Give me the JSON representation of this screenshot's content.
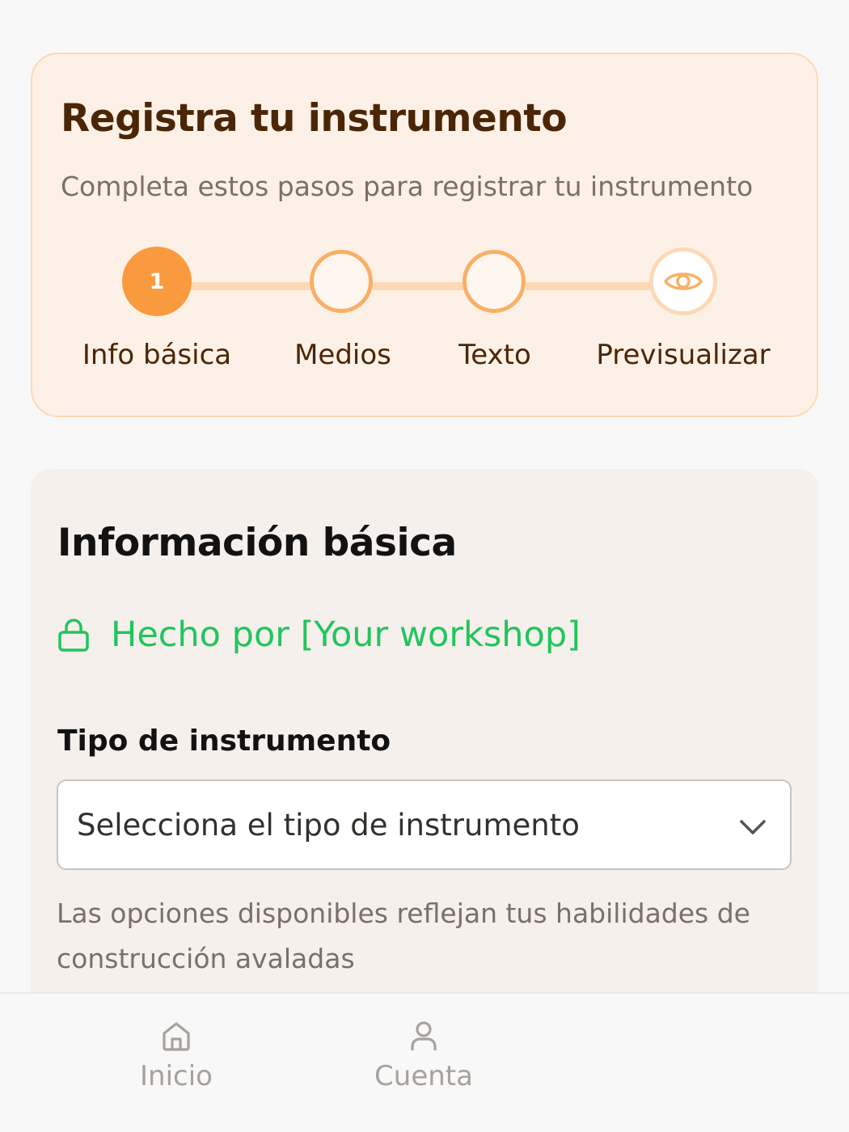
{
  "header": {
    "title": "Registra tu instrumento",
    "subtitle": "Completa estos pasos para registrar tu instrumento"
  },
  "stepper": {
    "steps": [
      {
        "label": "Info básica",
        "number": "1",
        "state": "active"
      },
      {
        "label": "Medios",
        "state": "pending"
      },
      {
        "label": "Texto",
        "state": "pending"
      },
      {
        "label": "Previsualizar",
        "icon": "eye-icon",
        "state": "preview"
      }
    ]
  },
  "form": {
    "section_title": "Información básica",
    "maker_text": "Hecho por [Your workshop]",
    "instrument_type_label": "Tipo de instrumento",
    "instrument_type_value": "Selecciona el tipo de instrumento",
    "instrument_type_help": "Las opciones disponibles reflejan tus habilidades de construcción avaladas"
  },
  "bottom_nav": {
    "items": [
      {
        "label": "Inicio",
        "icon": "home-icon"
      },
      {
        "label": "Cuenta",
        "icon": "user-icon"
      }
    ]
  },
  "colors": {
    "accent": "#fa9a3f",
    "accent_light": "#fcd9b6",
    "success": "#21c55d",
    "heading_brown": "#4a2606"
  }
}
